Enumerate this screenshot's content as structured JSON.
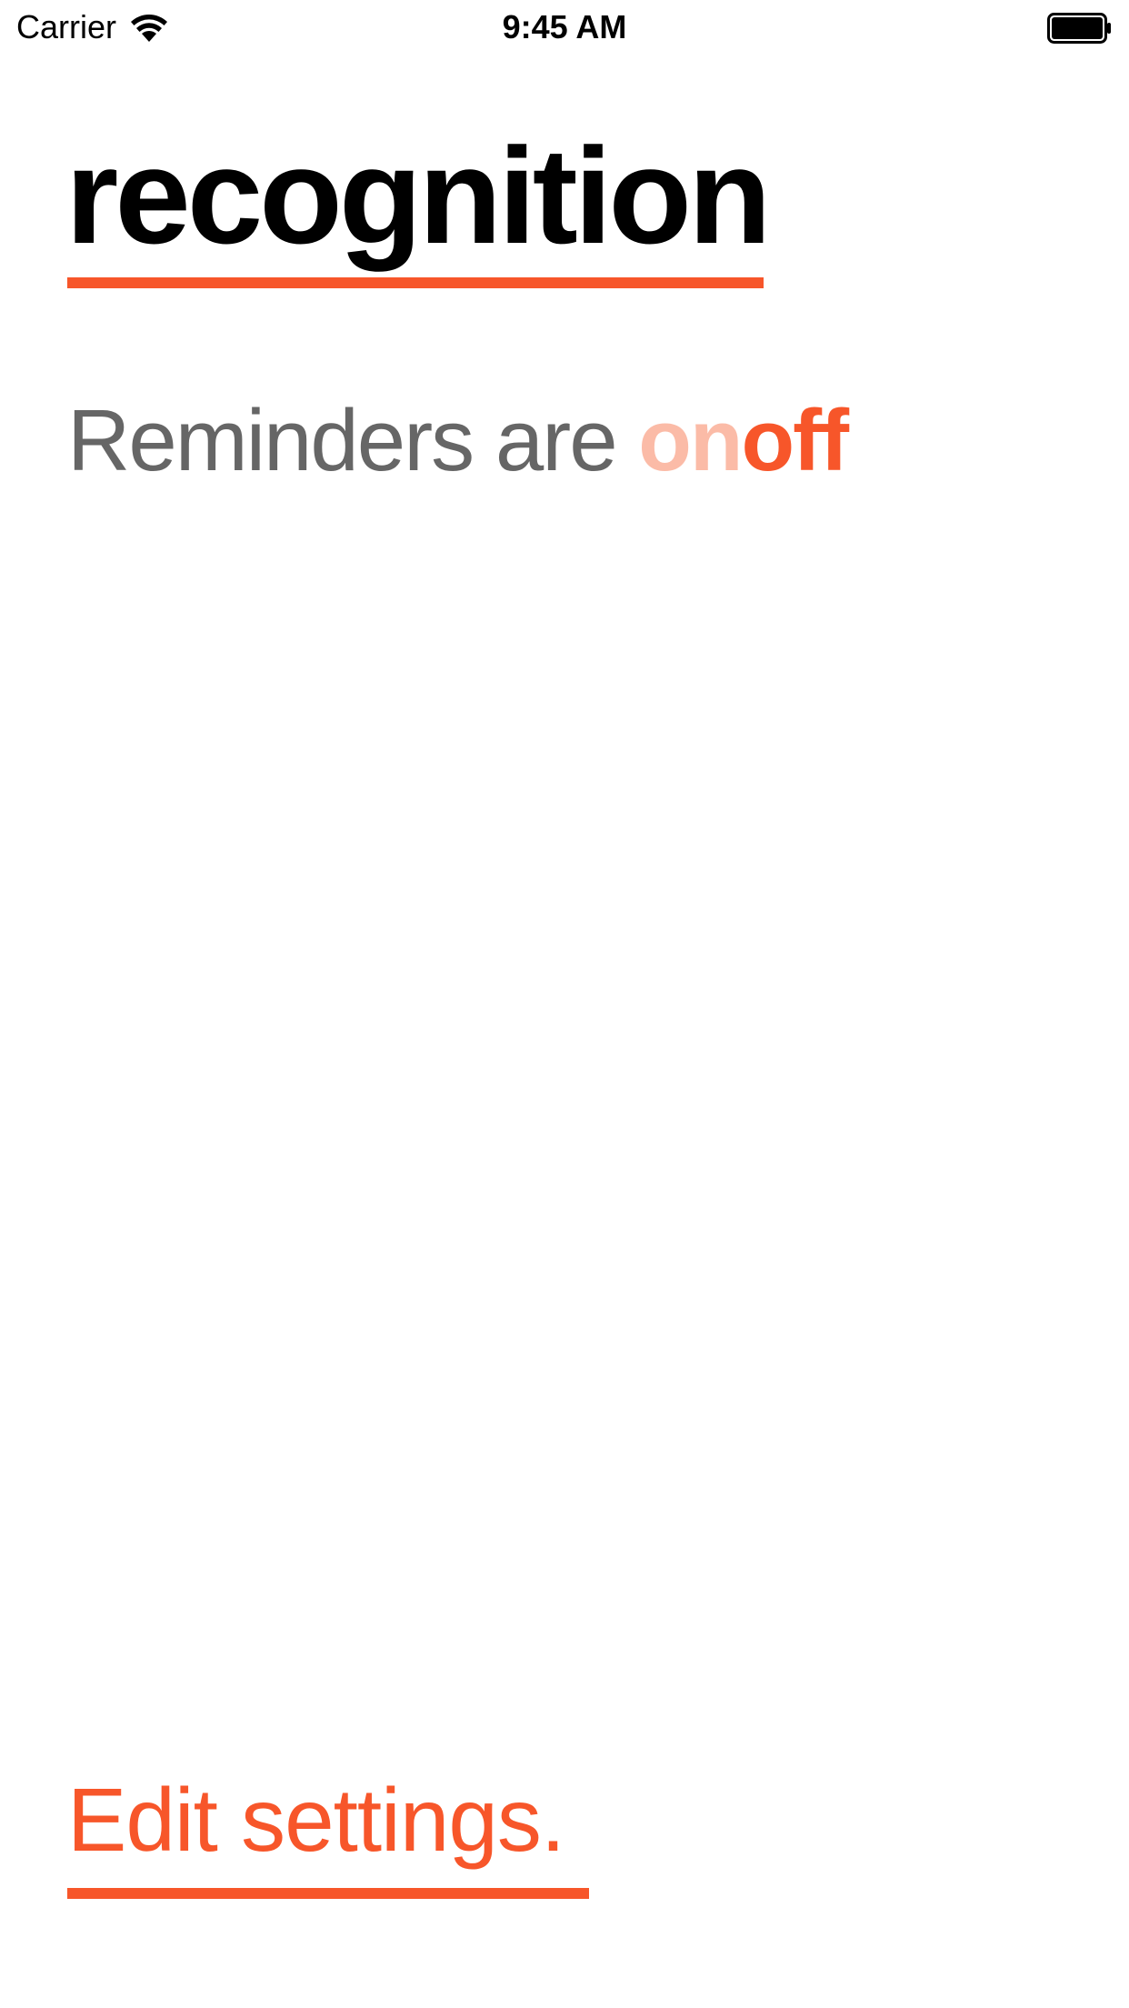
{
  "status_bar": {
    "carrier": "Carrier",
    "time": "9:45 AM",
    "wifi_icon": "wifi-icon",
    "battery_icon": "battery-icon"
  },
  "header": {
    "title": "recognition"
  },
  "reminders": {
    "prefix": "Reminders are ",
    "on_label": "on",
    "off_label": "off",
    "selected": "off"
  },
  "footer": {
    "edit_settings_label": "Edit settings."
  },
  "colors": {
    "accent": "#f7562a",
    "accent_muted": "#fbbba7",
    "body_text": "#666666",
    "title_text": "#000000",
    "background": "#ffffff"
  }
}
